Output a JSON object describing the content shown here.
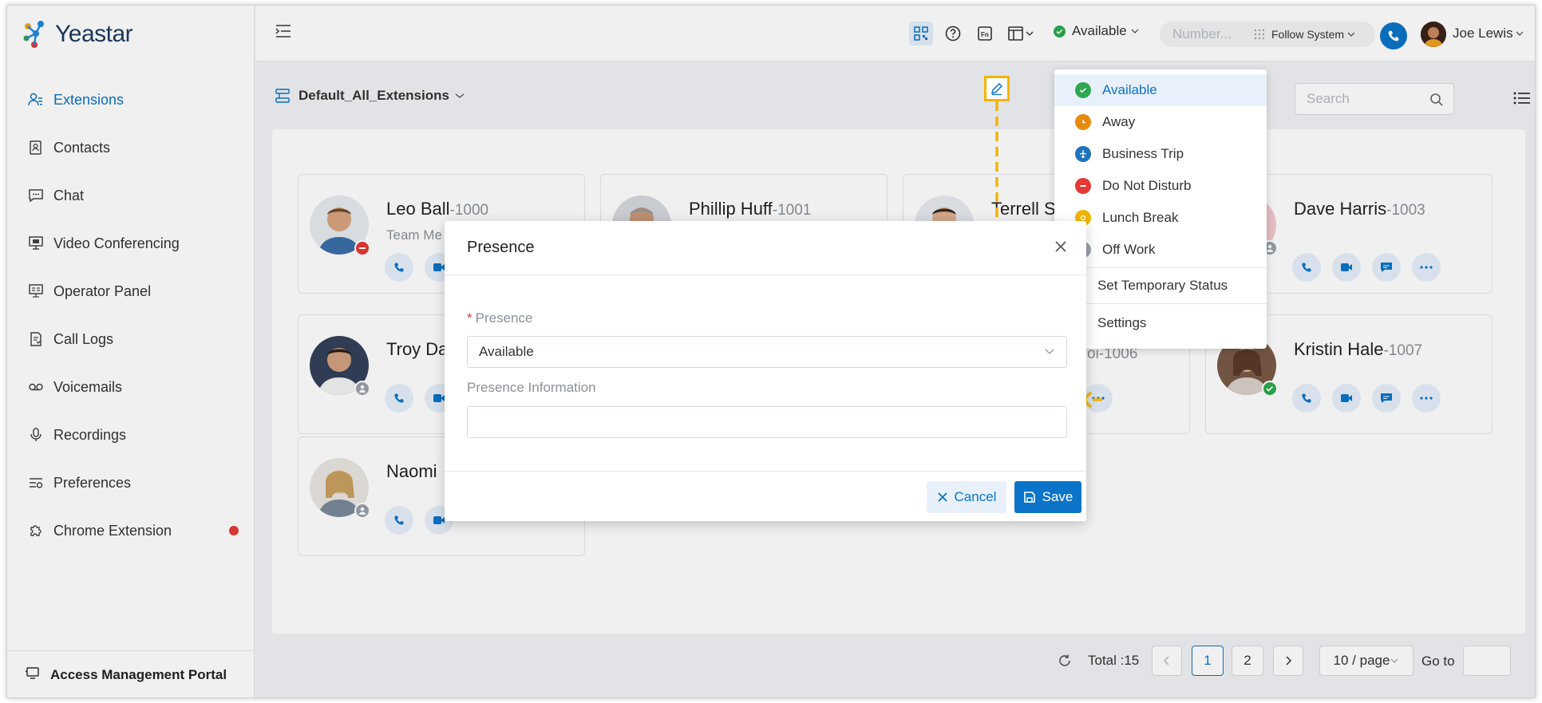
{
  "app": {
    "brand": "Yeastar"
  },
  "sidebar": {
    "items": [
      {
        "label": "Extensions",
        "icon": "user-group-icon",
        "active": true
      },
      {
        "label": "Contacts",
        "icon": "contacts-icon"
      },
      {
        "label": "Chat",
        "icon": "chat-icon"
      },
      {
        "label": "Video Conferencing",
        "icon": "monitor-icon"
      },
      {
        "label": "Operator Panel",
        "icon": "operator-panel-icon"
      },
      {
        "label": "Call Logs",
        "icon": "call-logs-icon"
      },
      {
        "label": "Voicemails",
        "icon": "voicemail-icon"
      },
      {
        "label": "Recordings",
        "icon": "microphone-icon"
      },
      {
        "label": "Preferences",
        "icon": "preferences-icon"
      },
      {
        "label": "Chrome Extension",
        "icon": "puzzle-icon",
        "has_dot": true
      }
    ],
    "portal_label": "Access Management Portal"
  },
  "header": {
    "status_label": "Available",
    "status_color": "#2ea84f",
    "dial_placeholder": "Number...",
    "follow_label": "Follow System",
    "user_name": "Joe Lewis"
  },
  "toolbar": {
    "group_label": "Default_All_Extensions",
    "search_placeholder": "Search"
  },
  "cards": [
    {
      "name": "Leo Ball",
      "ext": "-1000",
      "sub": "Team Me",
      "status_color": "#e53935"
    },
    {
      "name": "Phillip Huff",
      "ext": "-1001",
      "sub": ""
    },
    {
      "name": "Terrell S",
      "ext": "",
      "sub": ""
    },
    {
      "name": "Dave Harris",
      "ext": "-1003",
      "sub": "",
      "status_color": "#9aa1ab"
    },
    {
      "name": "Troy Da",
      "ext": "",
      "sub": "",
      "status_color": "#9aa1ab"
    },
    {
      "name": "",
      "ext": "oi-1006",
      "sub": ""
    },
    {
      "name": "Kristin Hale",
      "ext": "-1007",
      "sub": "",
      "status_color": "#2ea84f"
    },
    {
      "name": "Naomi",
      "ext": "",
      "sub": "",
      "status_color": "#9aa1ab"
    }
  ],
  "presence_menu": {
    "items": [
      {
        "label": "Available",
        "color": "#2ea84f",
        "selected": true
      },
      {
        "label": "Away",
        "color": "#e8890c"
      },
      {
        "label": "Business Trip",
        "color": "#1e73be"
      },
      {
        "label": "Do Not Disturb",
        "color": "#e53935"
      },
      {
        "label": "Lunch Break",
        "color": "#f0b400"
      },
      {
        "label": "Off Work",
        "color": "#9aa1ab"
      }
    ],
    "temporary_label": "Set Temporary Status",
    "settings_label": "Settings"
  },
  "modal": {
    "title": "Presence",
    "presence_label": "Presence",
    "presence_value": "Available",
    "info_label": "Presence Information",
    "info_value": "",
    "cancel_label": "Cancel",
    "save_label": "Save"
  },
  "pagination": {
    "total": "Total :15",
    "pages": [
      "1",
      "2"
    ],
    "current": "1",
    "page_size": "10 / page",
    "goto_label": "Go to"
  },
  "colors": {
    "accent": "#0b74c8",
    "highlight": "#f5b400"
  }
}
